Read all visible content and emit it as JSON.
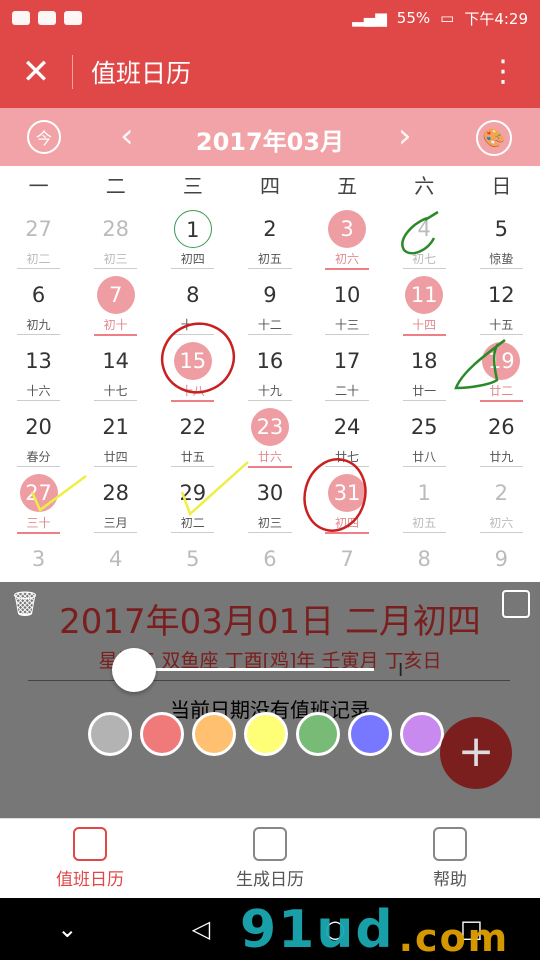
{
  "status": {
    "battery": "55%",
    "time": "下午4:29"
  },
  "appbar": {
    "title": "值班日历"
  },
  "month": {
    "title": "2017年03月"
  },
  "weekdays": [
    "一",
    "二",
    "三",
    "四",
    "五",
    "六",
    "日"
  ],
  "calendar": [
    [
      {
        "n": "27",
        "l": "初二",
        "s": "dim"
      },
      {
        "n": "28",
        "l": "初三",
        "s": "dim"
      },
      {
        "n": "1",
        "l": "初四",
        "s": "today"
      },
      {
        "n": "2",
        "l": "初五",
        "s": ""
      },
      {
        "n": "3",
        "l": "初六",
        "s": "hol"
      },
      {
        "n": "4",
        "l": "初七",
        "s": "dim"
      },
      {
        "n": "5",
        "l": "惊蛰",
        "s": ""
      }
    ],
    [
      {
        "n": "6",
        "l": "初九",
        "s": ""
      },
      {
        "n": "7",
        "l": "初十",
        "s": "hol"
      },
      {
        "n": "8",
        "l": "十一",
        "s": ""
      },
      {
        "n": "9",
        "l": "十二",
        "s": ""
      },
      {
        "n": "10",
        "l": "十三",
        "s": ""
      },
      {
        "n": "11",
        "l": "十四",
        "s": "hol"
      },
      {
        "n": "12",
        "l": "十五",
        "s": ""
      }
    ],
    [
      {
        "n": "13",
        "l": "十六",
        "s": ""
      },
      {
        "n": "14",
        "l": "十七",
        "s": ""
      },
      {
        "n": "15",
        "l": "十八",
        "s": "hol"
      },
      {
        "n": "16",
        "l": "十九",
        "s": ""
      },
      {
        "n": "17",
        "l": "二十",
        "s": ""
      },
      {
        "n": "18",
        "l": "廿一",
        "s": ""
      },
      {
        "n": "19",
        "l": "廿二",
        "s": "hol"
      }
    ],
    [
      {
        "n": "20",
        "l": "春分",
        "s": ""
      },
      {
        "n": "21",
        "l": "廿四",
        "s": ""
      },
      {
        "n": "22",
        "l": "廿五",
        "s": ""
      },
      {
        "n": "23",
        "l": "廿六",
        "s": "hol"
      },
      {
        "n": "24",
        "l": "廿七",
        "s": ""
      },
      {
        "n": "25",
        "l": "廿八",
        "s": ""
      },
      {
        "n": "26",
        "l": "廿九",
        "s": ""
      }
    ],
    [
      {
        "n": "27",
        "l": "三十",
        "s": "hol"
      },
      {
        "n": "28",
        "l": "三月",
        "s": ""
      },
      {
        "n": "29",
        "l": "初二",
        "s": ""
      },
      {
        "n": "30",
        "l": "初三",
        "s": ""
      },
      {
        "n": "31",
        "l": "初四",
        "s": "hol"
      },
      {
        "n": "1",
        "l": "初五",
        "s": "dim"
      },
      {
        "n": "2",
        "l": "初六",
        "s": "dim"
      }
    ],
    [
      {
        "n": "3",
        "l": "",
        "s": "dim"
      },
      {
        "n": "4",
        "l": "",
        "s": "dim"
      },
      {
        "n": "5",
        "l": "",
        "s": "dim"
      },
      {
        "n": "6",
        "l": "",
        "s": "dim"
      },
      {
        "n": "7",
        "l": "",
        "s": "dim"
      },
      {
        "n": "8",
        "l": "",
        "s": "dim"
      },
      {
        "n": "9",
        "l": "",
        "s": "dim"
      }
    ]
  ],
  "panel": {
    "date": "2017年03月01日 二月初四",
    "info": "星期三 双鱼座 丁酉[鸡]年 壬寅月 丁亥日",
    "empty_msg": "当前日期没有值班记录"
  },
  "swatch_colors": [
    "#b3b3b3",
    "#f07a7a",
    "#ffc070",
    "#ffff77",
    "#77bb77",
    "#7777ff",
    "#c88aee"
  ],
  "tabs": [
    {
      "label": "值班日历",
      "active": true
    },
    {
      "label": "生成日历",
      "active": false
    },
    {
      "label": "帮助",
      "active": false
    }
  ],
  "watermark": {
    "text": "91ud",
    "suffix": ".com"
  }
}
